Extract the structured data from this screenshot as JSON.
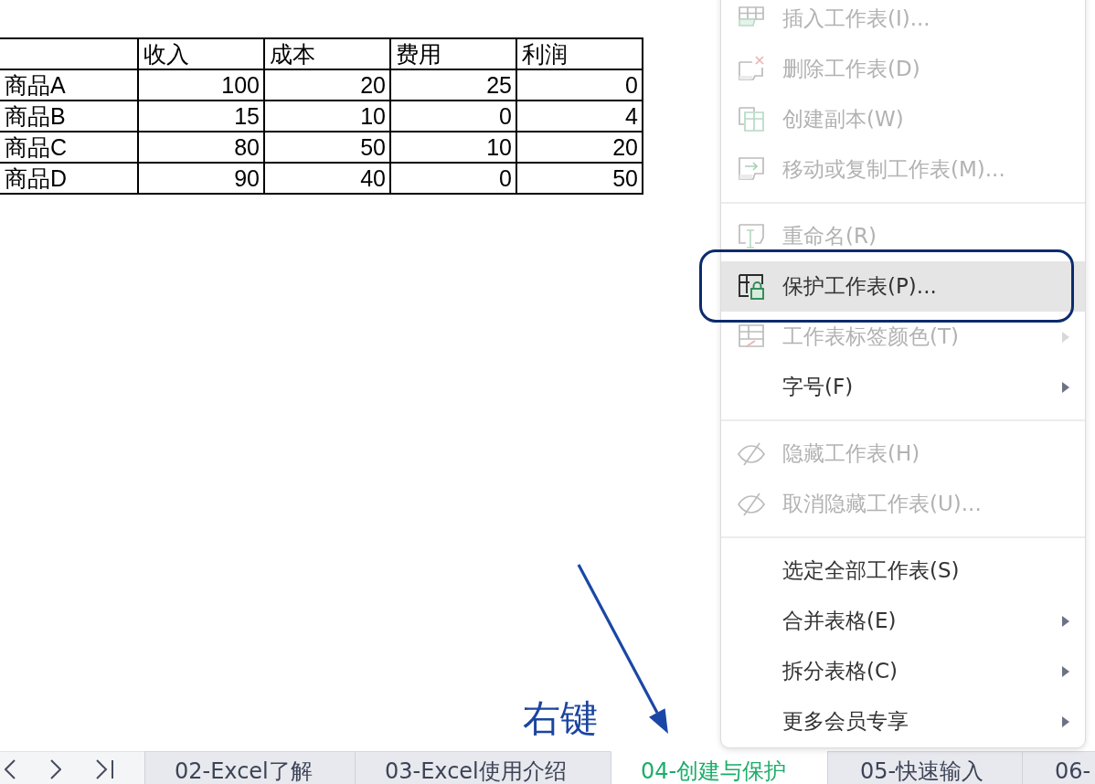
{
  "table": {
    "columns": [
      "收入",
      "成本",
      "费用",
      "利润"
    ],
    "rows": [
      {
        "name": "商品A",
        "values": [
          "100",
          "20",
          "25",
          "0"
        ]
      },
      {
        "name": "商品B",
        "values": [
          "15",
          "10",
          "0",
          "4"
        ]
      },
      {
        "name": "商品C",
        "values": [
          "80",
          "50",
          "10",
          "20"
        ]
      },
      {
        "name": "商品D",
        "values": [
          "90",
          "40",
          "0",
          "50"
        ]
      }
    ]
  },
  "menu": {
    "groups": [
      [
        {
          "label": "插入工作表(I)...",
          "disabled": true,
          "selected": false,
          "submenu": false
        },
        {
          "label": "删除工作表(D)",
          "disabled": true,
          "selected": false,
          "submenu": false
        },
        {
          "label": "创建副本(W)",
          "disabled": true,
          "selected": false,
          "submenu": false
        },
        {
          "label": "移动或复制工作表(M)...",
          "disabled": true,
          "selected": false,
          "submenu": false
        }
      ],
      [
        {
          "label": "重命名(R)",
          "disabled": true,
          "selected": false,
          "submenu": false
        },
        {
          "label": "保护工作表(P)...",
          "disabled": false,
          "selected": true,
          "submenu": false
        },
        {
          "label": "工作表标签颜色(T)",
          "disabled": true,
          "selected": false,
          "submenu": true
        },
        {
          "label": "字号(F)",
          "disabled": false,
          "selected": false,
          "submenu": true
        }
      ],
      [
        {
          "label": "隐藏工作表(H)",
          "disabled": true,
          "selected": false,
          "submenu": false
        },
        {
          "label": "取消隐藏工作表(U)...",
          "disabled": true,
          "selected": false,
          "submenu": false
        }
      ],
      [
        {
          "label": "选定全部工作表(S)",
          "disabled": false,
          "selected": false,
          "submenu": false
        },
        {
          "label": "合并表格(E)",
          "disabled": false,
          "selected": false,
          "submenu": true
        },
        {
          "label": "拆分表格(C)",
          "disabled": false,
          "selected": false,
          "submenu": true
        },
        {
          "label": "更多会员专享",
          "disabled": false,
          "selected": false,
          "submenu": true
        }
      ]
    ]
  },
  "annotation": {
    "label": "右键"
  },
  "sheet_tabs": [
    {
      "label": "02-Excel了解",
      "selected": false
    },
    {
      "label": "03-Excel使用介绍",
      "selected": false
    },
    {
      "label": "04-创建与保护",
      "selected": true
    },
    {
      "label": "05-快速输入",
      "selected": false
    },
    {
      "label": "06-",
      "selected": false
    }
  ]
}
